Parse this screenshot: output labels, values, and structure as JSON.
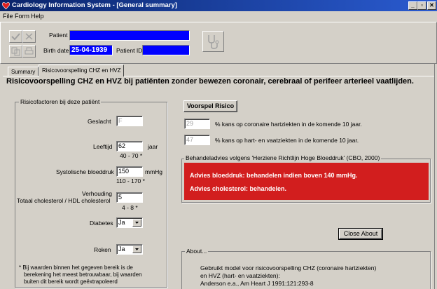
{
  "window": {
    "title": "Cardiology Information System - [General summary]",
    "buttons": {
      "min": "_",
      "max": "▫",
      "close": "✕"
    }
  },
  "menu": {
    "file": "File",
    "form": "Form",
    "help": "Help"
  },
  "header": {
    "patient_label": "Patient",
    "patient_value": "",
    "birth_date_label": "Birth date",
    "birth_date_value": "25-04-1939",
    "patient_id_label": "Patient ID",
    "patient_id_value": ""
  },
  "tabs": [
    {
      "label": "Summary"
    },
    {
      "label": "Risicovoorspelling CHZ en HVZ"
    }
  ],
  "heading": "Risicovoorspelling CHZ en HVZ bij patiënten zonder bewezen coronair, cerebraal of perifeer arterieel vaatlijden.",
  "risk_factors": {
    "title": "Risicofactoren bij deze patiënt",
    "geslacht_label": "Geslacht",
    "geslacht_value": "F",
    "leeftijd_label": "Leeftijd",
    "leeftijd_value": "62",
    "leeftijd_unit": "jaar",
    "leeftijd_range": "40 - 70 *",
    "bloeddruk_label": "Systolische bloeddruk",
    "bloeddruk_value": "150",
    "bloeddruk_unit": "mmHg",
    "bloeddruk_range": "110 - 170 *",
    "verhouding_label1": "Verhouding",
    "verhouding_label2": "Totaal cholesterol / HDL cholesterol",
    "verhouding_value": "5",
    "verhouding_range": "4 - 8 *",
    "diabetes_label": "Diabetes",
    "diabetes_value": "Ja",
    "roken_label": "Roken",
    "roken_value": "Ja",
    "footnote1": "* Bij waarden binnen het gegeven bereik is de",
    "footnote2": "berekening het meest betrouwbaar, bij waarden",
    "footnote3": "buiten dit bereik wordt geëxtrapoleerd"
  },
  "prediction": {
    "button_label": "Voorspel Risico",
    "chz_value": "29",
    "chz_text": "%  kans op coronaire hartziekten in de komende 10 jaar.",
    "hvz_value": "47",
    "hvz_text": "%  kans op hart- en vaatziekten in de komende 10 jaar."
  },
  "advice": {
    "title": "Behandeladvies volgens  'Herziene Richtlijn Hoge Bloeddruk' (CBO, 2000)",
    "line1": "Advies bloeddruk: behandelen indien boven 140 mmHg.",
    "line2": "Advies cholesterol: behandelen.",
    "color": "#d21e1e"
  },
  "about": {
    "close_label": "Close About",
    "title": "About...",
    "line1": "Gebruikt model voor risicovoorspelling CHZ (coronaire hartziekten)",
    "line2": "en HVZ (hart- en vaatziekten):",
    "line3": "Anderson e.a., Am Heart J  1991;121:293-8"
  }
}
